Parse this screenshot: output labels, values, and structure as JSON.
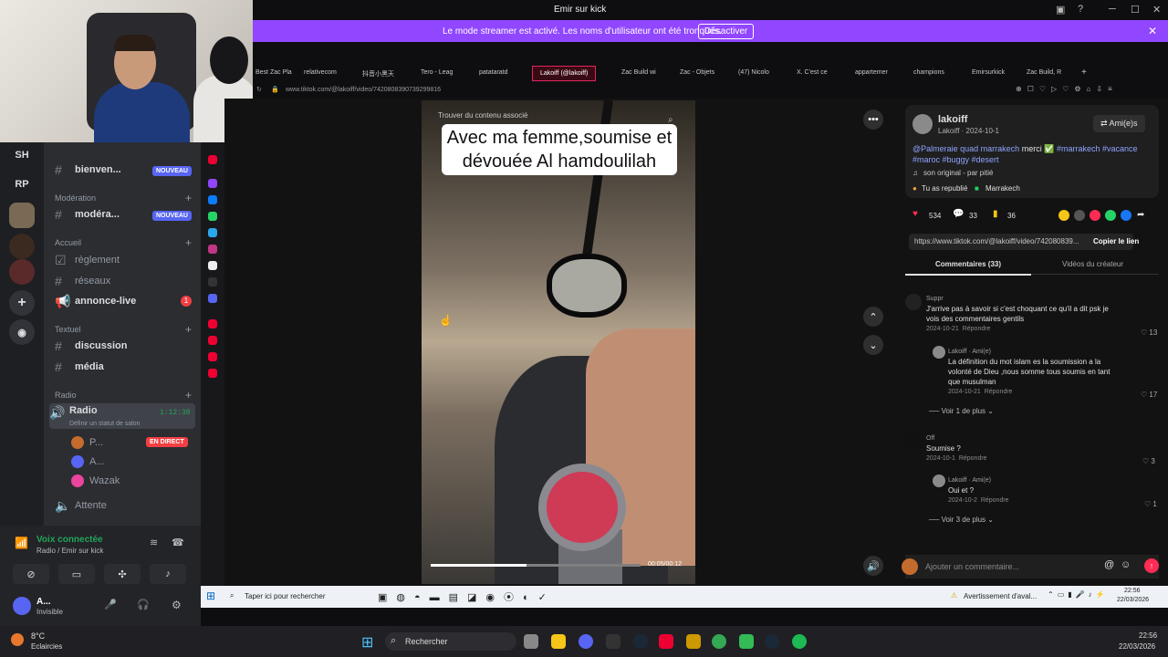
{
  "webcam": {},
  "window": {
    "title": "Emir sur kick"
  },
  "streamer_bar": {
    "message": "Le mode streamer est activé. Les noms d'utilisateur ont été tronqués.",
    "button": "Désactiver"
  },
  "servers": [
    "SH",
    "RP"
  ],
  "channels": {
    "items": [
      {
        "label": "bienven...",
        "badge": "NOUVEAU"
      },
      {
        "category": "Modération"
      },
      {
        "label": "modéra...",
        "badge": "NOUVEAU"
      },
      {
        "category": "Accueil"
      },
      {
        "label": "règlement"
      },
      {
        "label": "réseaux"
      },
      {
        "label": "annonce-live",
        "count": "1"
      },
      {
        "category": "Textuel"
      },
      {
        "label": "discussion"
      },
      {
        "label": "média"
      },
      {
        "category": "Radio"
      },
      {
        "label": "Radio",
        "time": "1:12:38",
        "sub": "Définir un statut de salon"
      },
      {
        "label": "P...",
        "badge": "EN DIRECT"
      },
      {
        "label": "A..."
      },
      {
        "label": "Wazak"
      },
      {
        "label": "Attente"
      }
    ]
  },
  "voice": {
    "connected": "Voix connectée",
    "sub": "Radio / Emir sur kick",
    "user": "A...",
    "status": "Invisible"
  },
  "tabs": [
    "Best Zac Pla",
    "relativecom",
    "抖音小黑天",
    "Tero - Leag",
    "patataratd",
    "Lakoiff (@lakoiff)",
    "Zac Build wi",
    "Zac - Objets",
    "(47) Nicolo",
    "X. C'est ce",
    "appartemer",
    "champions",
    "Emirsurkick",
    "Zac Build, R"
  ],
  "address": "www.tiktok.com/@lakoiff/video/7420808390739299816",
  "video": {
    "search_placeholder": "Trouver du contenu associé",
    "caption": "Avec ma femme,soumise et dévouée Al hamdoulilah",
    "time": "00:05/00:12"
  },
  "post": {
    "username": "lakoiff",
    "meta": "Lakoiff · 2024-10-1",
    "friends": "Ami(e)s",
    "desc_mention": "@Palmeraie quad marrakech",
    "desc_text": "merci",
    "hashtags_line1": "#marrakech #vacance",
    "hashtags_line2": "#maroc #buggy #desert",
    "sound": "son original - par pitié",
    "reposted": "Tu as republié",
    "location": "Marrakech",
    "likes": "534",
    "comments": "33",
    "saves": "36",
    "link": "https://www.tiktok.com/@lakoiff/video/742080839...",
    "copy": "Copier le lien",
    "tab_comments": "Commentaires (33)",
    "tab_videos": "Vidéos du créateur",
    "add_comment": "Ajouter un commentaire..."
  },
  "comments": [
    {
      "name": "Suppr",
      "text1": "J'arrive pas à savoir si c'est choquant ce qu'il a dit psk je",
      "text2": "vois des commentaires gentils",
      "date": "2024-10-21",
      "reply": "Répondre",
      "likes": "13"
    },
    {
      "name": "Lakoiff · Ami(e)",
      "text1": "La définition du mot islam es la soumission a la",
      "text2": "volonté de Dieu ,nous somme tous soumis en tant",
      "text3": "que musulman",
      "date": "2024-10-21",
      "reply": "Répondre",
      "likes": "17"
    },
    {
      "more": "Voir 1 de plus"
    },
    {
      "name": "Off",
      "text1": "Soumise ?",
      "date": "2024-10-1",
      "reply": "Répondre",
      "likes": "3"
    },
    {
      "name": "Lakoiff · Ami(e)",
      "text1": "Oui et ?",
      "date": "2024-10-2",
      "reply": "Répondre",
      "likes": "1"
    },
    {
      "more": "Voir 3 de plus"
    }
  ],
  "win_taskbar": {
    "search": "Taper ici pour rechercher",
    "alert": "Avertissement d'aval...",
    "time": "22:56",
    "date": "22/03/2026"
  },
  "main_taskbar": {
    "weather_temp": "8°C",
    "weather": "Eclaircies",
    "search": "Rechercher",
    "time": "22:56",
    "date": "22/03/2026"
  }
}
